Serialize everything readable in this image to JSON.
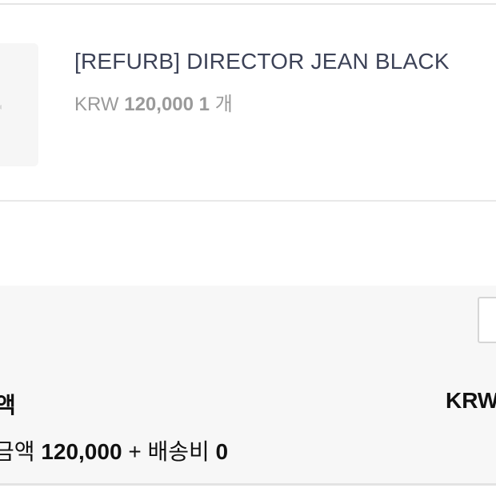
{
  "product": {
    "name": "[REFURB] DIRECTOR JEAN BLACK",
    "currency": "KRW",
    "price": "120,000",
    "quantity": "1",
    "quantity_unit": "개"
  },
  "summary": {
    "total_label": "액",
    "total_value": "KRW",
    "breakdown": {
      "label_prefix": "금액",
      "amount": "120,000",
      "plus": "+",
      "shipping_label": "배송비",
      "shipping_amount": "0"
    }
  },
  "colors": {
    "product_name": "#3c4257",
    "price_text": "#9a9a9a",
    "panel_bg": "#f7f7f7",
    "border": "#e5e5e5"
  }
}
